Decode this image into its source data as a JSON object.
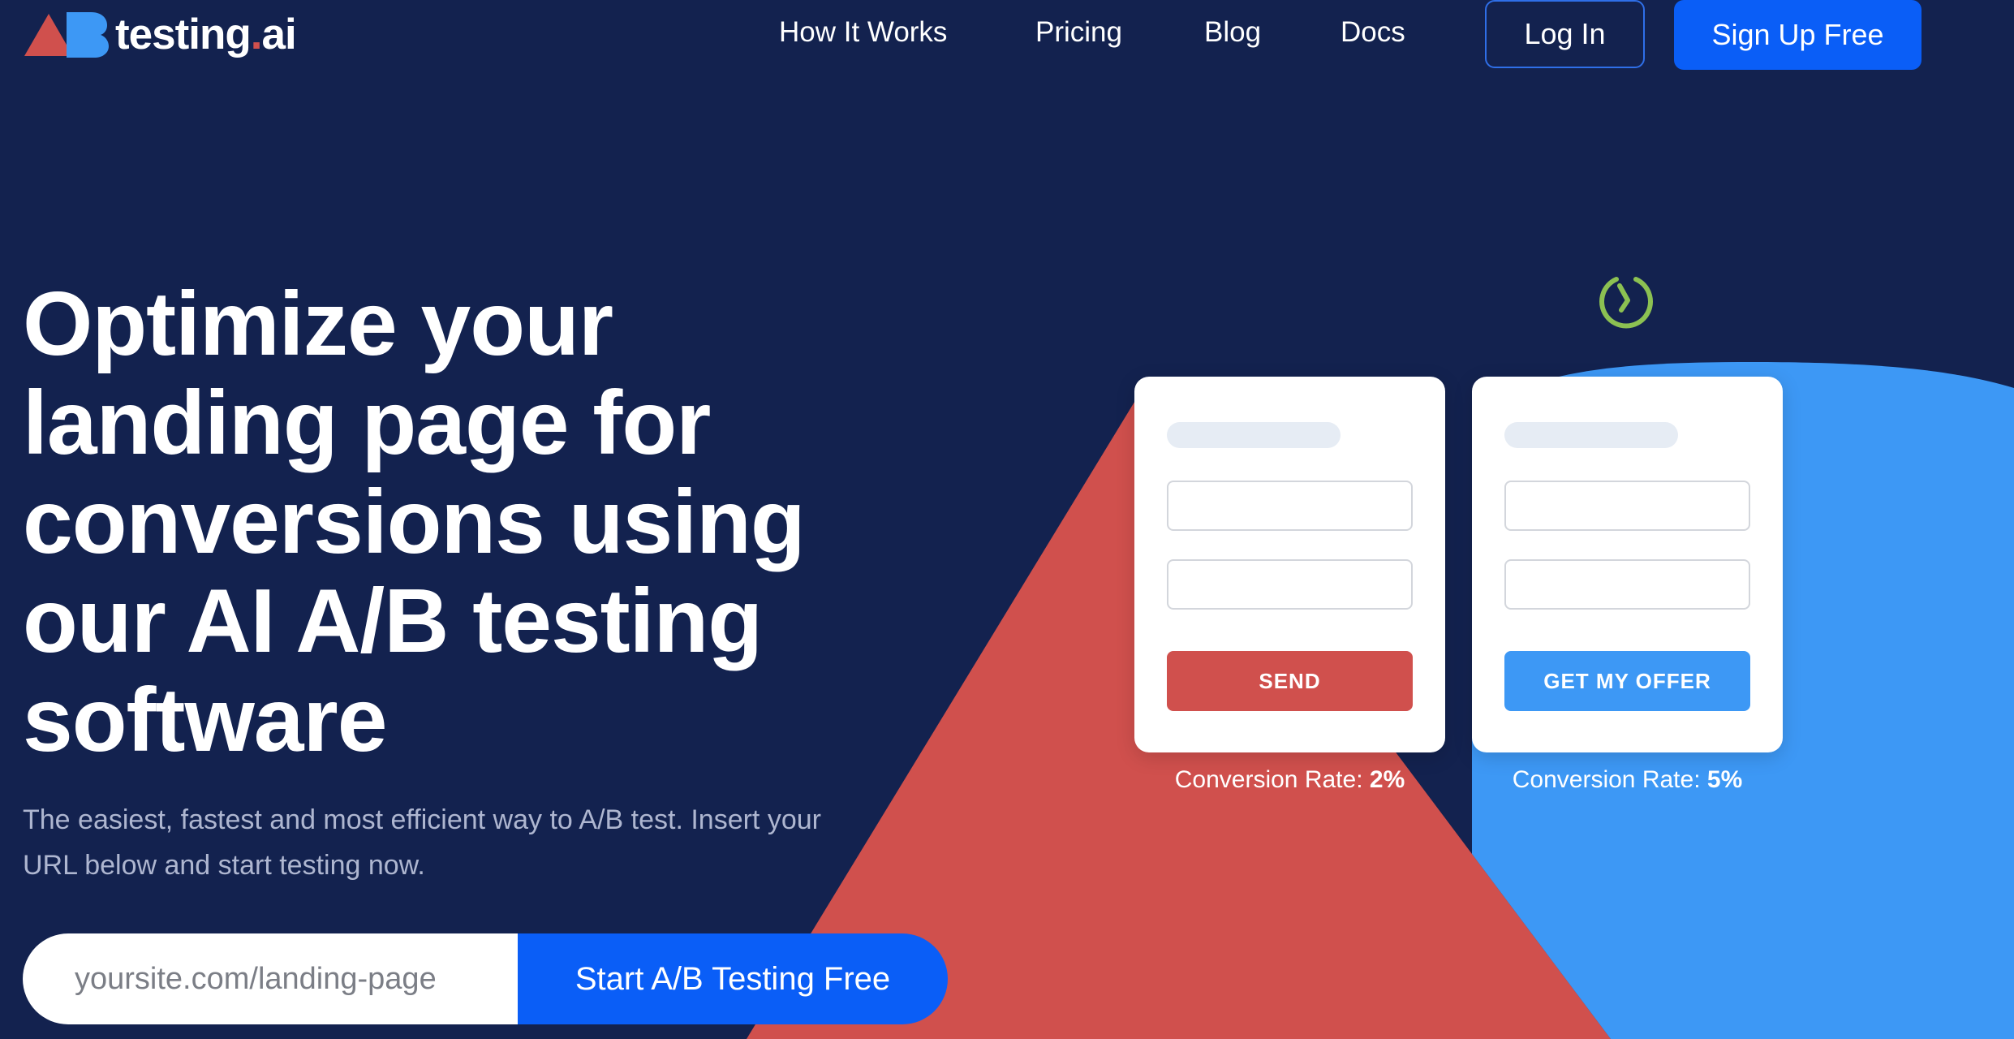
{
  "brand": {
    "name": "testing",
    "dot": ".",
    "tld": "ai",
    "logo_icon": "ab-logo-icon",
    "colors": {
      "red": "#d0504d",
      "blue": "#3d98f5",
      "primary": "#0a5ef7",
      "background": "#13224f"
    }
  },
  "nav": {
    "links": [
      "How It Works",
      "Pricing",
      "Blog",
      "Docs"
    ],
    "login_label": "Log In",
    "signup_label": "Sign Up Free"
  },
  "hero": {
    "title": "Optimize your landing page for conversions using our AI A/B testing software",
    "subtitle": "The easiest, fastest and most efficient way to A/B test. Insert your URL below and start testing now.",
    "url_placeholder": "yoursite.com/landing-page",
    "cta_label": "Start A/B Testing Free"
  },
  "illustration": {
    "timer_icon": "timer-icon",
    "variant_a": {
      "button_label": "SEND",
      "conversion_label": "Conversion Rate:",
      "conversion_value": "2%"
    },
    "variant_b": {
      "button_label": "GET MY OFFER",
      "conversion_label": "Conversion Rate:",
      "conversion_value": "5%"
    }
  }
}
